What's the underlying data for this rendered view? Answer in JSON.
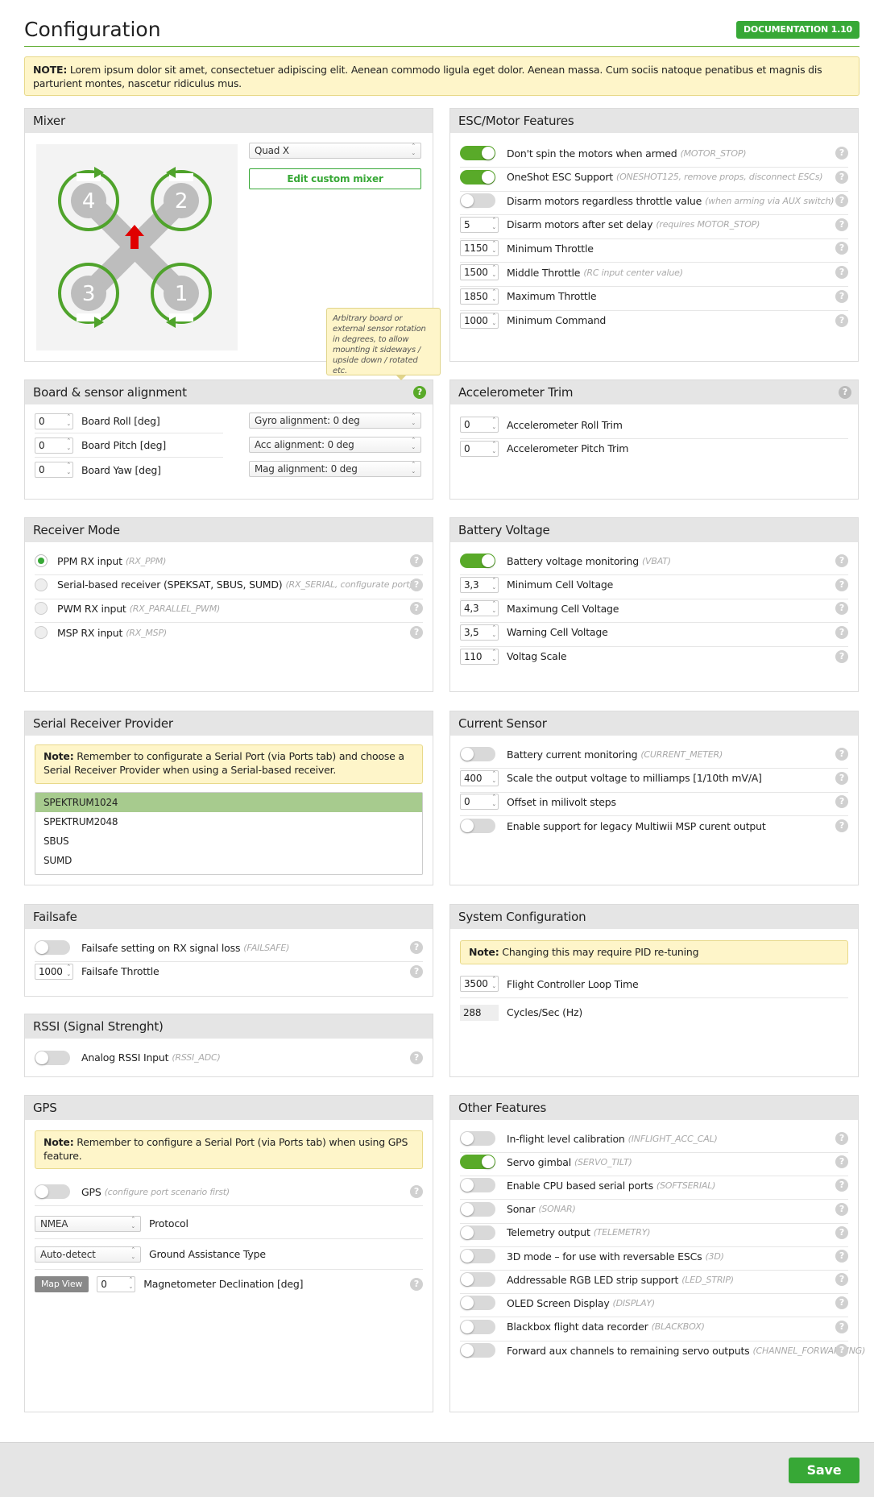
{
  "page": {
    "title": "Configuration",
    "doc_button": "DOCUMENTATION 1.10",
    "save": "Save"
  },
  "top_note": {
    "bold": "NOTE:",
    "text": " Lorem ipsum dolor sit amet, consectetuer adipiscing elit. Aenean commodo ligula eget dolor. Aenean massa. Cum sociis natoque penatibus et magnis dis parturient montes, nascetur ridiculus mus."
  },
  "colors": {
    "accent": "#37a836",
    "header": "#e5e5e5",
    "note": "#fef5c9",
    "selected": "#a7cb8e",
    "arrow": "#e00000"
  },
  "help_glyph": "?",
  "mixer": {
    "title": "Mixer",
    "type": "Quad X",
    "edit_button": "Edit custom mixer",
    "motors": [
      "4",
      "2",
      "3",
      "1"
    ]
  },
  "esc": {
    "title": "ESC/Motor Features",
    "rows": [
      {
        "label": "Don't spin the motors when armed",
        "hint": "(MOTOR_STOP)",
        "toggle": true
      },
      {
        "label": "OneShot ESC Support",
        "hint": "(ONESHOT125, remove props, disconnect ESCs)",
        "toggle": true
      },
      {
        "label": "Disarm motors regardless throttle value",
        "hint": "(when arming via AUX switch)",
        "toggle": false
      },
      {
        "label": "Disarm motors after set delay",
        "hint": "(requires MOTOR_STOP)",
        "value": "5"
      },
      {
        "label": "Minimum Throttle",
        "hint": "",
        "value": "1150"
      },
      {
        "label": "Middle Throttle",
        "hint": "(RC input center value)",
        "value": "1500"
      },
      {
        "label": "Maximum Throttle",
        "hint": "",
        "value": "1850"
      },
      {
        "label": "Minimum Command",
        "hint": "",
        "value": "1000"
      }
    ]
  },
  "tooltip": "Arbitrary board or external sensor rotation in degrees, to allow mounting it sideways / upside down / rotated etc.",
  "board": {
    "title": "Board & sensor alignment",
    "rows": [
      {
        "label": "Board Roll [deg]",
        "value": "0",
        "select": "Gyro alignment: 0 deg"
      },
      {
        "label": "Board Pitch [deg]",
        "value": "0",
        "select": "Acc alignment: 0 deg"
      },
      {
        "label": "Board Yaw [deg]",
        "value": "0",
        "select": "Mag alignment: 0 deg"
      }
    ]
  },
  "acc": {
    "title": "Accelerometer Trim",
    "rows": [
      {
        "label": "Accelerometer Roll Trim",
        "value": "0"
      },
      {
        "label": "Accelerometer Pitch Trim",
        "value": "0"
      }
    ]
  },
  "receiver": {
    "title": "Receiver Mode",
    "rows": [
      {
        "label": "PPM RX input",
        "hint": "(RX_PPM)",
        "selected": true
      },
      {
        "label": "Serial-based receiver (SPEKSAT, SBUS, SUMD)",
        "hint": "(RX_SERIAL, configurate port)",
        "selected": false
      },
      {
        "label": "PWM RX input",
        "hint": "(RX_PARALLEL_PWM)",
        "selected": false
      },
      {
        "label": "MSP RX input",
        "hint": "(RX_MSP)",
        "selected": false
      }
    ]
  },
  "battery": {
    "title": "Battery Voltage",
    "rows": [
      {
        "label": "Battery voltage monitoring",
        "hint": "(VBAT)",
        "toggle": true
      },
      {
        "label": "Minimum Cell Voltage",
        "value": "3,3"
      },
      {
        "label": "Maximung Cell Voltage",
        "value": "4,3"
      },
      {
        "label": "Warning Cell Voltage",
        "value": "3,5"
      },
      {
        "label": "Voltag Scale",
        "value": "110"
      }
    ]
  },
  "serialrx": {
    "title": "Serial Receiver Provider",
    "note_bold": "Note:",
    "note": " Remember to configurate a Serial Port (via Ports tab) and choose a Serial Receiver Provider when using a Serial-based receiver.",
    "options": [
      "SPEKTRUM1024",
      "SPEKTRUM2048",
      "SBUS",
      "SUMD"
    ]
  },
  "current": {
    "title": "Current Sensor",
    "rows": [
      {
        "label": "Battery current monitoring",
        "hint": "(CURRENT_METER)",
        "toggle": false
      },
      {
        "label": "Scale the output voltage to milliamps [1/10th mV/A]",
        "value": "400"
      },
      {
        "label": "Offset in milivolt steps",
        "value": "0"
      },
      {
        "label": "Enable support for legacy Multiwii MSP curent output",
        "toggle": false
      }
    ]
  },
  "failsafe": {
    "title": "Failsafe",
    "rows": [
      {
        "label": "Failsafe setting on RX signal loss",
        "hint": "(FAILSAFE)",
        "toggle": false
      },
      {
        "label": "Failsafe Throttle",
        "value": "1000"
      }
    ]
  },
  "system": {
    "title": "System Configuration",
    "note_bold": "Note:",
    "note": " Changing this may require PID re-tuning",
    "rows": [
      {
        "label": "Flight Controller Loop Time",
        "value": "3500"
      },
      {
        "label": "Cycles/Sec (Hz)",
        "value": "288"
      }
    ]
  },
  "rssi": {
    "title": "RSSI (Signal Strenght)",
    "label": "Analog RSSI Input",
    "hint": "(RSSI_ADC)",
    "toggle": false
  },
  "gps": {
    "title": "GPS",
    "note_bold": "Note:",
    "note": " Remember to configure a Serial Port (via Ports tab) when using GPS feature.",
    "gps_label": "GPS",
    "gps_hint": "(configure port scenario first)",
    "protocol": "NMEA",
    "protocol_label": "Protocol",
    "assist": "Auto-detect",
    "assist_label": "Ground Assistance Type",
    "map_button": "Map View",
    "decl_value": "0",
    "decl_label": "Magnetometer Declination [deg]"
  },
  "other": {
    "title": "Other Features",
    "rows": [
      {
        "label": "In-flight level calibration",
        "hint": "(INFLIGHT_ACC_CAL)",
        "toggle": false
      },
      {
        "label": "Servo gimbal",
        "hint": "(SERVO_TILT)",
        "toggle": true
      },
      {
        "label": "Enable CPU based serial ports",
        "hint": "(SOFTSERIAL)",
        "toggle": false
      },
      {
        "label": "Sonar",
        "hint": "(SONAR)",
        "toggle": false
      },
      {
        "label": "Telemetry output",
        "hint": "(TELEMETRY)",
        "toggle": false
      },
      {
        "label": "3D mode – for use with reversable ESCs",
        "hint": "(3D)",
        "toggle": false
      },
      {
        "label": "Addressable RGB LED strip support",
        "hint": "(LED_STRIP)",
        "toggle": false
      },
      {
        "label": "OLED Screen Display",
        "hint": "(DISPLAY)",
        "toggle": false
      },
      {
        "label": "Blackbox flight data recorder",
        "hint": "(BLACKBOX)",
        "toggle": false
      },
      {
        "label": "Forward aux channels to remaining servo outputs",
        "hint": "(CHANNEL_FORWARDING)",
        "toggle": false
      }
    ]
  }
}
